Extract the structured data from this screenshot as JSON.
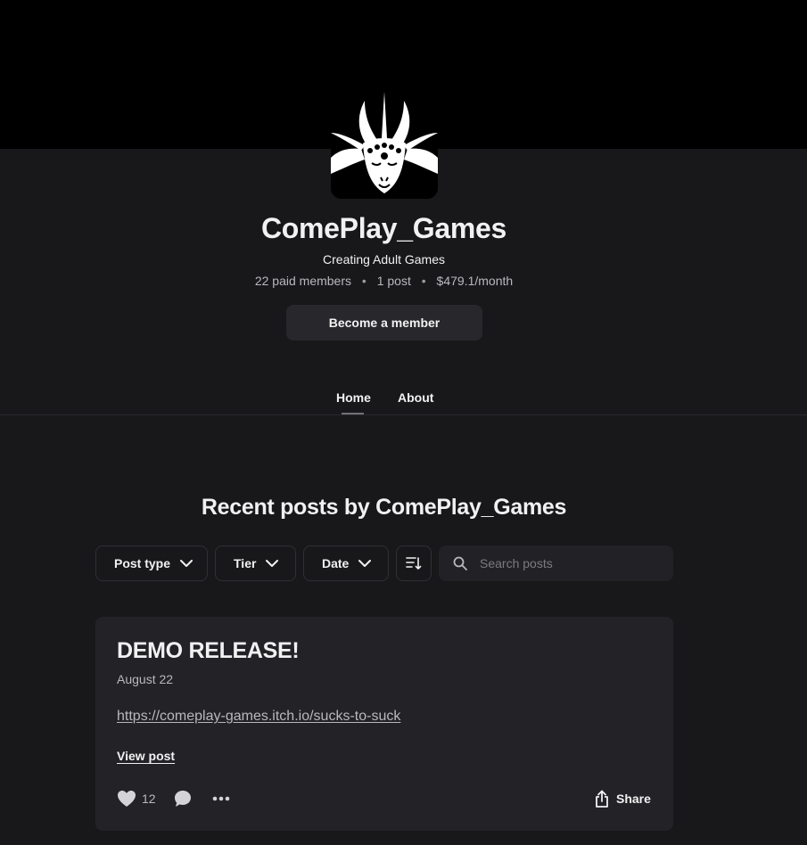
{
  "creator": {
    "name": "ComePlay_Games",
    "tagline": "Creating Adult Games",
    "stats": {
      "members": "22 paid members",
      "posts": "1 post",
      "earnings": "$479.1/month"
    },
    "member_button": "Become a member"
  },
  "nav": {
    "tabs": [
      {
        "label": "Home",
        "active": true
      },
      {
        "label": "About",
        "active": false
      }
    ]
  },
  "posts_section": {
    "title": "Recent posts by ComePlay_Games",
    "filters": {
      "post_type": "Post type",
      "tier": "Tier",
      "date": "Date"
    },
    "search_placeholder": "Search posts"
  },
  "post": {
    "title": "DEMO RELEASE!",
    "date": "August 22",
    "link": "https://comeplay-games.itch.io/sucks-to-suck",
    "view_label": "View post",
    "likes": "12",
    "share_label": "Share"
  },
  "icons": {
    "avatar": "goat-logo-icon",
    "chevron": "chevron-down-icon",
    "sort": "sort-icon",
    "search": "search-icon",
    "like": "heart-icon",
    "comment": "comment-icon",
    "more": "more-icon",
    "share": "share-icon"
  },
  "colors": {
    "background": "#18181b",
    "banner": "#000000",
    "card": "#232327",
    "button": "#28282c"
  }
}
